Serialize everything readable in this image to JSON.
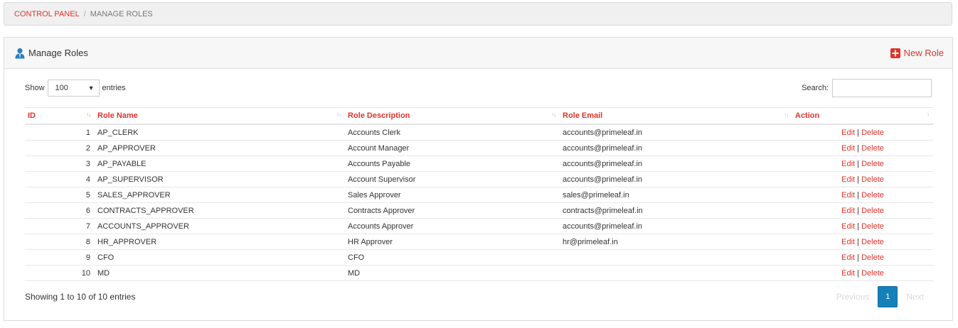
{
  "breadcrumb": {
    "root": "CONTROL PANEL",
    "separator": "/",
    "current": "MANAGE ROLES"
  },
  "panel": {
    "title": "Manage Roles",
    "title_icon": "user-icon",
    "new_button": "New Role",
    "new_button_icon": "plus-square-icon"
  },
  "controls": {
    "show_label": "Show",
    "page_size": "100",
    "entries_label": "entries",
    "search_label": "Search:",
    "search_value": ""
  },
  "table": {
    "columns": [
      "ID",
      "Role Name",
      "Role Description",
      "Role Email",
      "Action"
    ],
    "rows": [
      {
        "id": "1",
        "name": "AP_CLERK",
        "description": "Accounts Clerk",
        "email": "accounts@primeleaf.in"
      },
      {
        "id": "2",
        "name": "AP_APPROVER",
        "description": "Account Manager",
        "email": "accounts@primeleaf.in"
      },
      {
        "id": "3",
        "name": "AP_PAYABLE",
        "description": "Accounts Payable",
        "email": "accounts@primeleaf.in"
      },
      {
        "id": "4",
        "name": "AP_SUPERVISOR",
        "description": "Account Supervisor",
        "email": "accounts@primeleaf.in"
      },
      {
        "id": "5",
        "name": "SALES_APPROVER",
        "description": "Sales Approver",
        "email": "sales@primeleaf.in"
      },
      {
        "id": "6",
        "name": "CONTRACTS_APPROVER",
        "description": "Contracts Approver",
        "email": "contracts@primeleaf.in"
      },
      {
        "id": "7",
        "name": "ACCOUNTS_APPROVER",
        "description": "Accounts Approver",
        "email": "accounts@primeleaf.in"
      },
      {
        "id": "8",
        "name": "HR_APPROVER",
        "description": "HR Approver",
        "email": "hr@primeleaf.in"
      },
      {
        "id": "9",
        "name": "CFO",
        "description": "CFO",
        "email": ""
      },
      {
        "id": "10",
        "name": "MD",
        "description": "MD",
        "email": ""
      }
    ],
    "action_edit": "Edit",
    "action_separator": "|",
    "action_delete": "Delete"
  },
  "footer": {
    "info": "Showing 1 to 10 of 10 entries",
    "previous": "Previous",
    "current_page": "1",
    "next": "Next"
  },
  "colors": {
    "accent": "#e0342b",
    "page_active": "#1680b8",
    "icon_blue": "#2a7fc1"
  }
}
